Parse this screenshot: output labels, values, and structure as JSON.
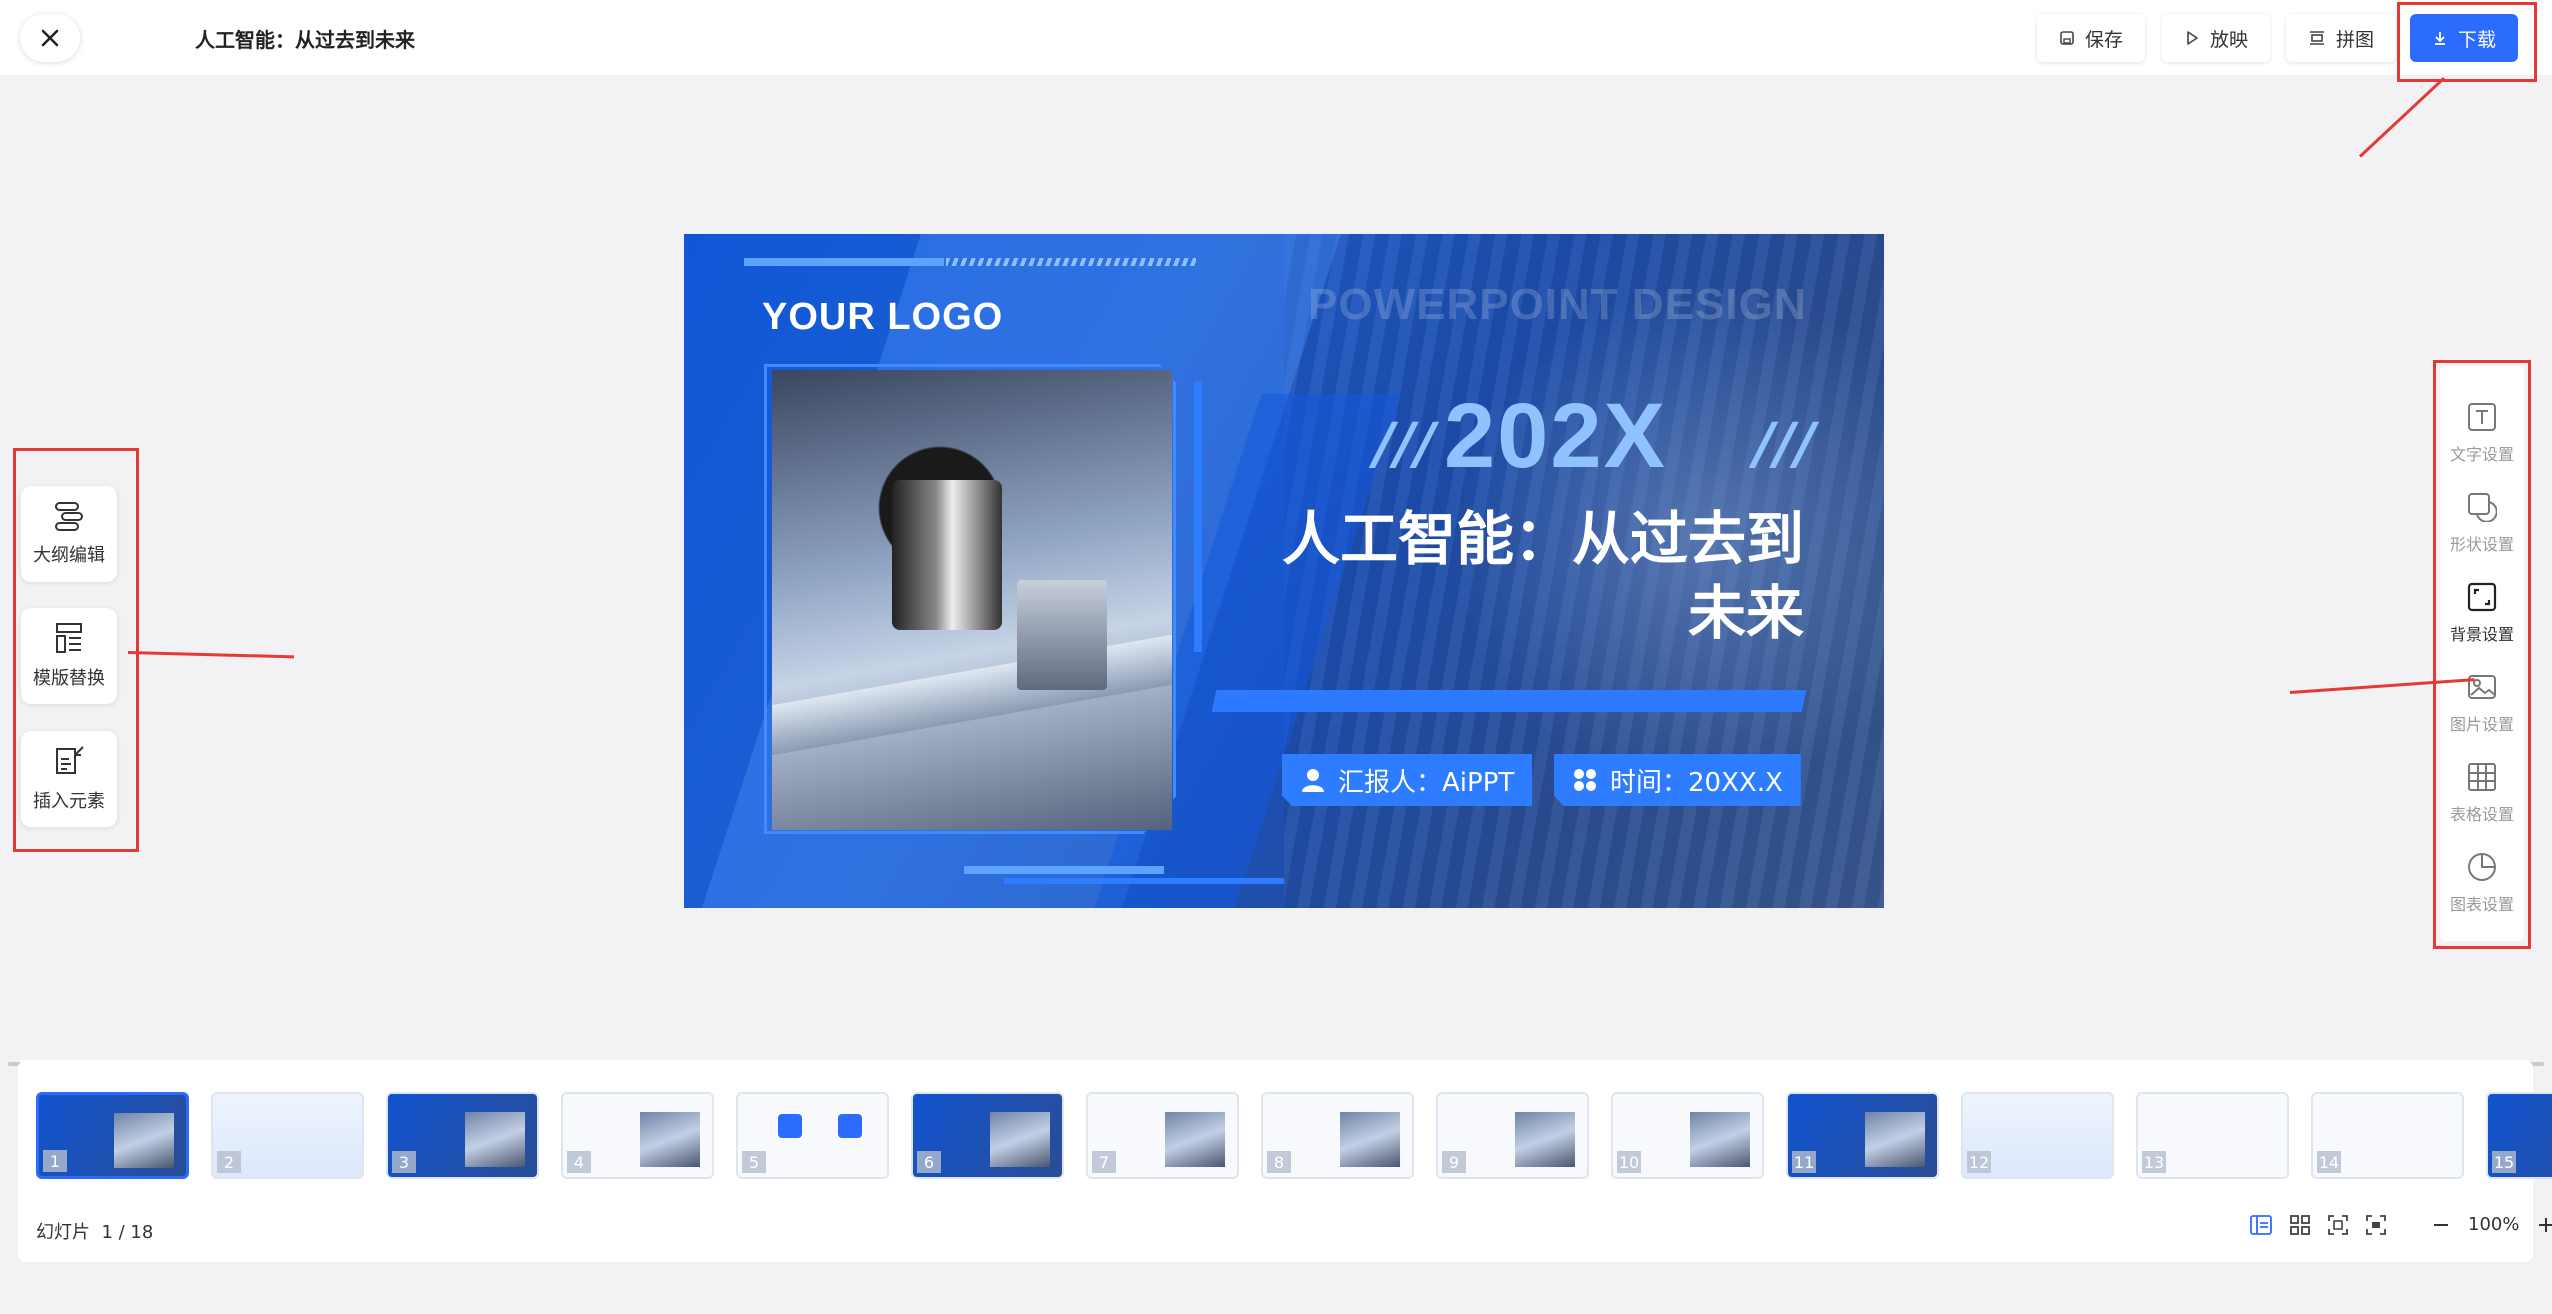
{
  "header": {
    "title": "人工智能：从过去到未来",
    "buttons": {
      "save": "保存",
      "present": "放映",
      "collage": "拼图",
      "download": "下载"
    }
  },
  "left_toolbar": [
    {
      "label": "大纲编辑",
      "icon": "outline-icon"
    },
    {
      "label": "模版替换",
      "icon": "template-icon"
    },
    {
      "label": "插入元素",
      "icon": "insert-element-icon"
    }
  ],
  "right_toolbar": [
    {
      "label": "文字设置",
      "icon": "text-icon",
      "active": false
    },
    {
      "label": "形状设置",
      "icon": "shape-icon",
      "active": false
    },
    {
      "label": "背景设置",
      "icon": "background-icon",
      "active": true
    },
    {
      "label": "图片设置",
      "icon": "image-icon",
      "active": false
    },
    {
      "label": "表格设置",
      "icon": "table-icon",
      "active": false
    },
    {
      "label": "图表设置",
      "icon": "chart-icon",
      "active": false
    }
  ],
  "slide": {
    "logo": "YOUR LOGO",
    "watermark": "POWERPOINT DESIGN",
    "year": "202X",
    "title_line1": "人工智能：从过去到",
    "title_line2": "未来",
    "reporter": "汇报人：AiPPT",
    "time": "时间：20XX.X"
  },
  "thumbnails": {
    "numbers": [
      "1",
      "2",
      "3",
      "4",
      "5",
      "6",
      "7",
      "8",
      "9",
      "10",
      "11",
      "12",
      "13",
      "14",
      "15"
    ],
    "selected": 1
  },
  "footer": {
    "slide_label": "幻灯片",
    "slide_counter": "1 / 18",
    "zoom": "100%"
  },
  "colors": {
    "accent": "#2b6cff",
    "annotation_red": "#e53935"
  }
}
